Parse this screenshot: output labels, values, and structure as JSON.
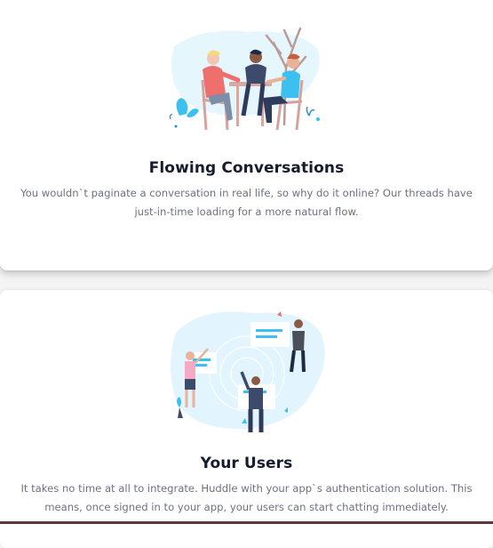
{
  "features": [
    {
      "title": "Flowing Conversations",
      "text": "You wouldn`t paginate a conversation in real life, so why do it online? Our threads have just-in-time loading for a more natural flow.",
      "illustration": "people-at-table-illustration"
    },
    {
      "title": "Your Users",
      "text": "It takes no time at all to integrate. Huddle with your app`s authentication solution. This means, once signed in to your app, your users can start chatting immediately.",
      "illustration": "users-network-illustration"
    }
  ],
  "colors": {
    "title": "#161c2d",
    "text": "#6e7181",
    "accent_blue": "#3bc0f0",
    "light_blue": "#e2f4fd"
  }
}
